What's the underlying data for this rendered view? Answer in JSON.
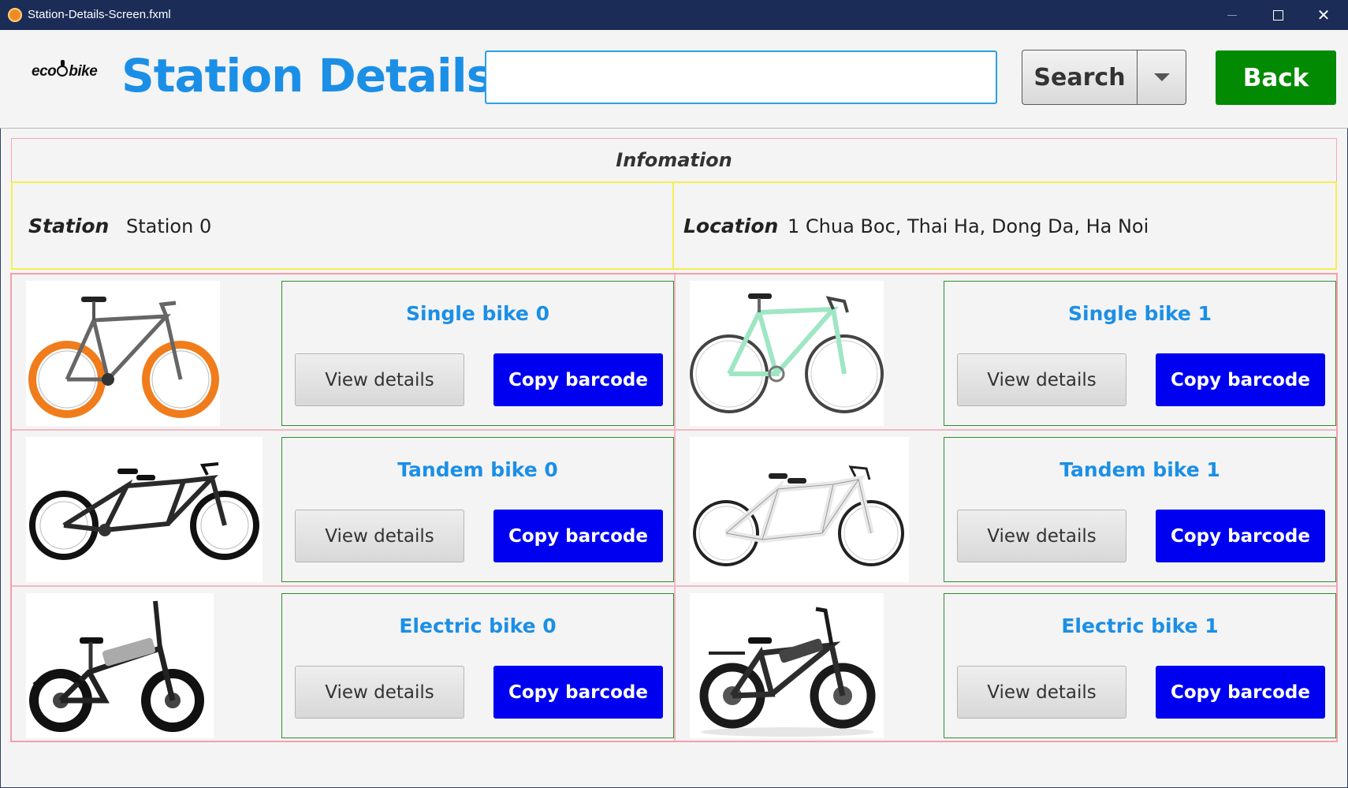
{
  "window": {
    "title": "Station-Details-Screen.fxml",
    "icon": "app-icon"
  },
  "header": {
    "logo": "ecobike",
    "title": "Station Details",
    "search_value": "",
    "search_label": "Search",
    "back_label": "Back",
    "accent_color": "#1b8fe6",
    "back_color": "#038a03"
  },
  "info": {
    "title": "Infomation",
    "station_label": "Station",
    "station_value": "Station 0",
    "location_label": "Location",
    "location_value": "1 Chua Boc, Thai Ha, Dong Da, Ha Noi"
  },
  "bikes": [
    {
      "name": "Single bike 0",
      "view_label": "View details",
      "copy_label": "Copy barcode",
      "image": "orange-single-bike-image"
    },
    {
      "name": "Single bike 1",
      "view_label": "View details",
      "copy_label": "Copy barcode",
      "image": "mint-single-bike-image"
    },
    {
      "name": "Tandem bike 0",
      "view_label": "View details",
      "copy_label": "Copy barcode",
      "image": "black-tandem-bike-image"
    },
    {
      "name": "Tandem bike 1",
      "view_label": "View details",
      "copy_label": "Copy barcode",
      "image": "white-tandem-bike-image"
    },
    {
      "name": "Electric bike 0",
      "view_label": "View details",
      "copy_label": "Copy barcode",
      "image": "folding-electric-bike-image"
    },
    {
      "name": "Electric bike 1",
      "view_label": "View details",
      "copy_label": "Copy barcode",
      "image": "fat-tire-electric-bike-image"
    }
  ],
  "colors": {
    "copy_button": "#0000f0",
    "card_border": "#2f8f2f",
    "grid_border": "#f4a0ae",
    "station_border": "#f5ef50"
  }
}
